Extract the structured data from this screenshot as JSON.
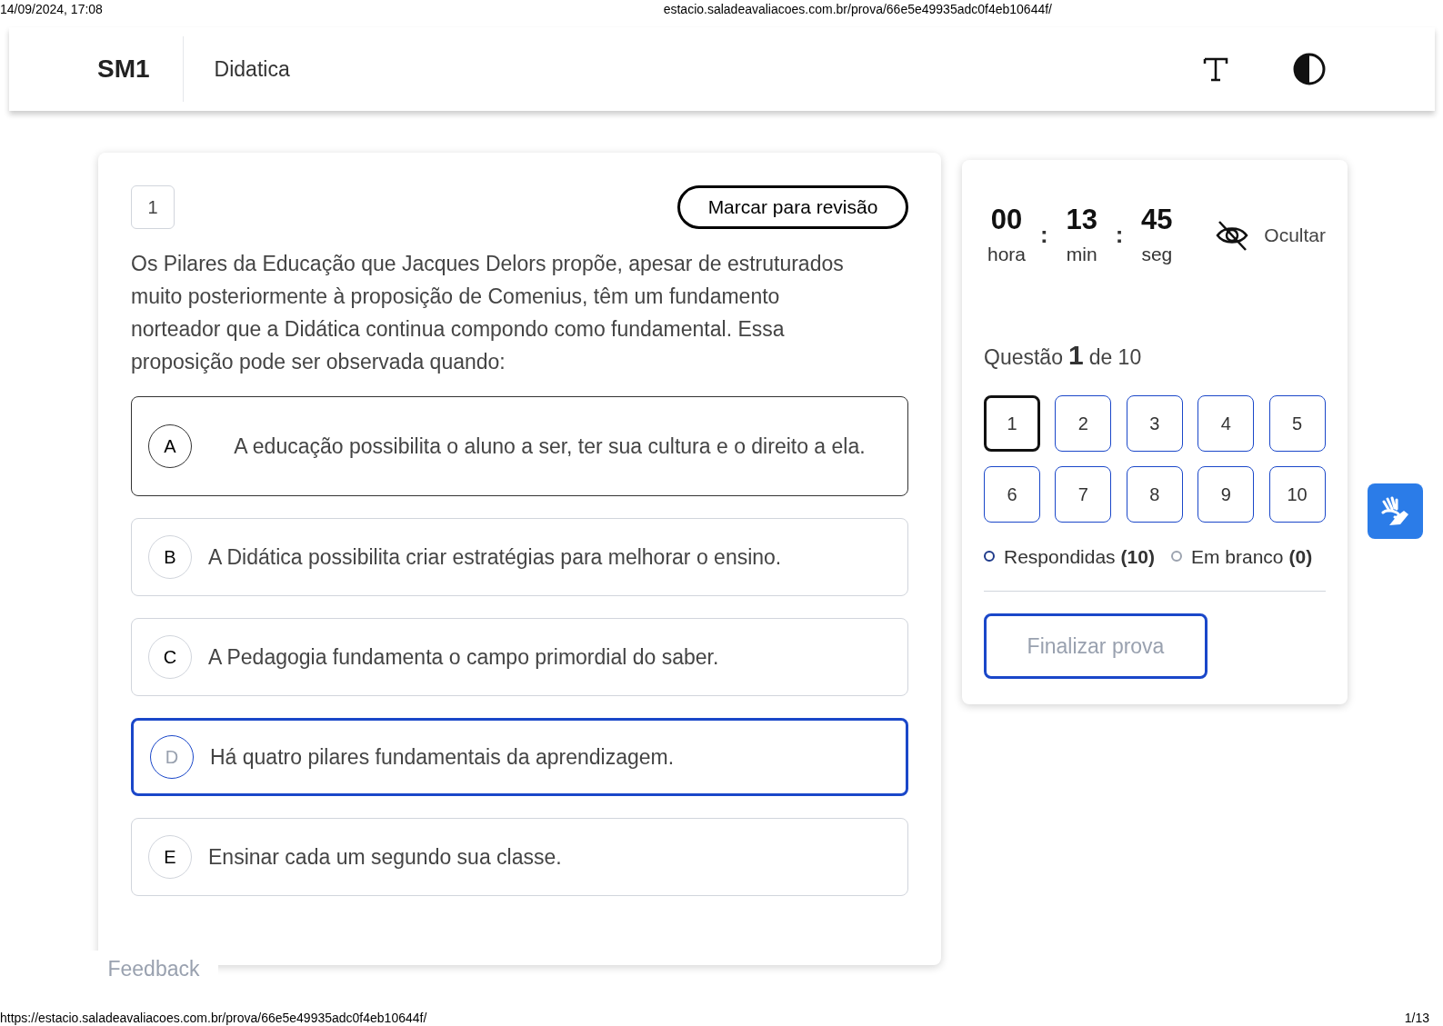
{
  "print_header": {
    "datetime": "14/09/2024, 17:08",
    "url": "estacio.saladeavaliacoes.com.br/prova/66e5e49935adc0f4eb10644f/"
  },
  "header": {
    "logo": "SM1",
    "course": "Didatica"
  },
  "question": {
    "number": "1",
    "review_button": "Marcar para revisão",
    "text": "Os Pilares da Educação que Jacques Delors propõe, apesar de estruturados muito posteriormente à proposição de Comenius, têm um fundamento norteador que a Didática continua compondo como fundamental. Essa proposição pode ser observada quando:",
    "options": [
      {
        "letter": "A",
        "text": "A educação possibilita o aluno a ser, ter sua cultura e o direito a ela.",
        "selected": false,
        "focused": true
      },
      {
        "letter": "B",
        "text": "A Didática possibilita criar estratégias para melhorar o ensino.",
        "selected": false,
        "focused": false
      },
      {
        "letter": "C",
        "text": "A Pedagogia fundamenta o campo primordial do saber.",
        "selected": false,
        "focused": false
      },
      {
        "letter": "D",
        "text": "Há quatro pilares fundamentais da aprendizagem.",
        "selected": true,
        "focused": false
      },
      {
        "letter": "E",
        "text": "Ensinar cada um segundo sua classe.",
        "selected": false,
        "focused": false
      }
    ]
  },
  "timer": {
    "parts": [
      {
        "value": "00",
        "unit": "hora"
      },
      {
        "value": "13",
        "unit": "min"
      },
      {
        "value": "45",
        "unit": "seg"
      }
    ],
    "separators": [
      ":",
      ":"
    ],
    "hide_label": "Ocultar"
  },
  "progress": {
    "prefix": "Questão",
    "current": "1",
    "suffix": "de 10",
    "questions": [
      {
        "label": "1",
        "selected": true
      },
      {
        "label": "2",
        "selected": false
      },
      {
        "label": "3",
        "selected": false
      },
      {
        "label": "4",
        "selected": false
      },
      {
        "label": "5",
        "selected": false
      },
      {
        "label": "6",
        "selected": false
      },
      {
        "label": "7",
        "selected": false
      },
      {
        "label": "8",
        "selected": false
      },
      {
        "label": "9",
        "selected": false
      },
      {
        "label": "10",
        "selected": false
      }
    ],
    "legend": [
      {
        "label": "Respondidas",
        "count": "(10)",
        "color": "#1e3a8a"
      },
      {
        "label": "Em branco",
        "count": "(0)",
        "color": "#9ca3af"
      }
    ],
    "finish_button": "Finalizar prova"
  },
  "feedback": "Feedback",
  "print_footer": {
    "url": "https://estacio.saladeavaliacoes.com.br/prova/66e5e49935adc0f4eb10644f/",
    "page": "1/13"
  }
}
